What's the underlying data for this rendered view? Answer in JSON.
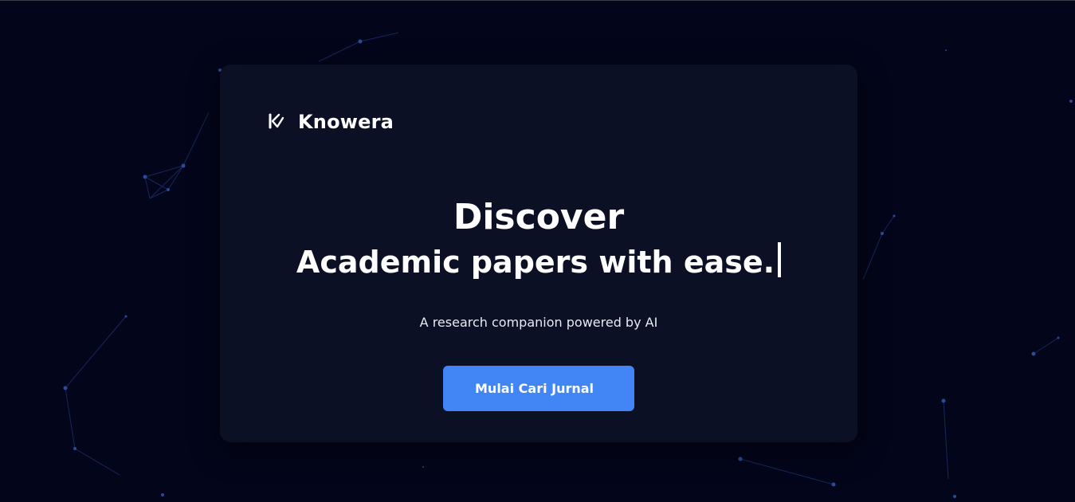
{
  "brand": {
    "name": "Knowera",
    "logo_icon": "knowera-k-logo-icon"
  },
  "hero": {
    "line1": "Discover",
    "line2": "Academic papers with ease."
  },
  "subtitle": "A research companion powered by AI",
  "cta": {
    "label": "Mulai Cari Jurnal"
  },
  "colors": {
    "page_background": "#03051a",
    "card_background": "#0c1025",
    "accent": "#4285f4",
    "network_nodes": "#2a4a9a"
  }
}
